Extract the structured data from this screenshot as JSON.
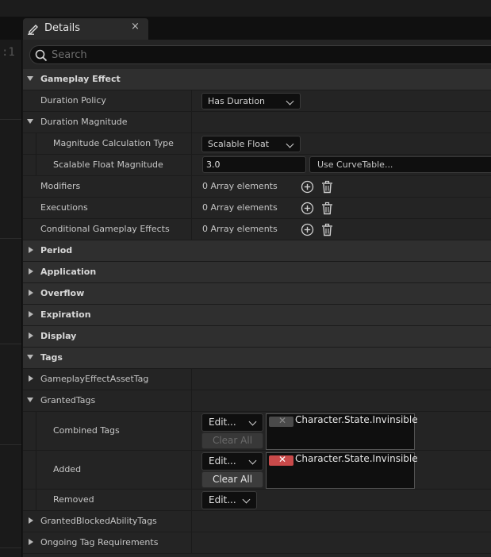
{
  "tab": {
    "title": "Details",
    "close": "×"
  },
  "search": {
    "placeholder": "Search"
  },
  "sidebar_digit": ":1",
  "gameplay_effect": {
    "header": "Gameplay Effect",
    "duration_policy": {
      "label": "Duration Policy",
      "value": "Has Duration"
    },
    "duration_magnitude": {
      "label": "Duration Magnitude",
      "magnitude_calc_type": {
        "label": "Magnitude Calculation Type",
        "value": "Scalable Float"
      },
      "scalable_float": {
        "label": "Scalable Float Magnitude",
        "value": "3.0",
        "curve": "Use CurveTable..."
      }
    },
    "modifiers": {
      "label": "Modifiers",
      "value": "0 Array elements"
    },
    "executions": {
      "label": "Executions",
      "value": "0 Array elements"
    },
    "conditional": {
      "label": "Conditional Gameplay Effects",
      "value": "0 Array elements"
    }
  },
  "categories": {
    "period": "Period",
    "application": "Application",
    "overflow": "Overflow",
    "expiration": "Expiration",
    "display": "Display"
  },
  "tags": {
    "header": "Tags",
    "asset_tag": "GameplayEffectAssetTag",
    "granted_tags": "GrantedTags",
    "combined": {
      "label": "Combined Tags",
      "edit": "Edit...",
      "clear": "Clear All",
      "tag": "Character.State.Invinsible"
    },
    "added": {
      "label": "Added",
      "edit": "Edit...",
      "clear": "Clear All",
      "tag": "Character.State.Invinsible"
    },
    "removed": {
      "label": "Removed",
      "edit": "Edit..."
    },
    "granted_blocked": "GrantedBlockedAbilityTags",
    "ongoing": "Ongoing Tag Requirements"
  },
  "colors": {
    "panel_bg": "#242424",
    "category_bg": "#2f2f2f",
    "remove_tag_red": "#c94a4a",
    "disabled_tag_gray": "#4a4a4a"
  }
}
